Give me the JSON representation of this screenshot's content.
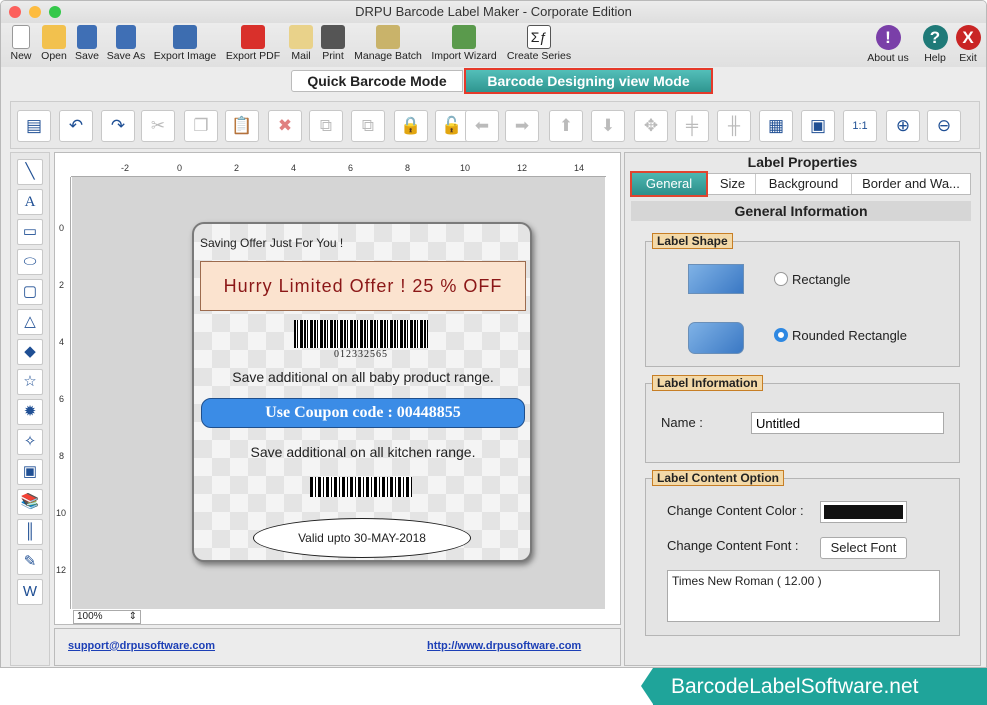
{
  "window": {
    "title": "DRPU Barcode Label Maker - Corporate Edition"
  },
  "toolbar": {
    "new": "New",
    "open": "Open",
    "save": "Save",
    "save_as": "Save As",
    "export_image": "Export Image",
    "export_pdf": "Export PDF",
    "mail": "Mail",
    "print": "Print",
    "manage_batch": "Manage Batch",
    "import_wizard": "Import Wizard",
    "create_series": "Create Series",
    "about": "About us",
    "help": "Help",
    "exit": "Exit"
  },
  "modes": {
    "quick": "Quick Barcode Mode",
    "designing": "Barcode Designing view Mode"
  },
  "ruler": {
    "h_ticks": [
      "-2",
      "0",
      "2",
      "4",
      "6",
      "8",
      "10",
      "12",
      "14"
    ],
    "v_ticks": [
      "0",
      "2",
      "4",
      "6",
      "8",
      "10",
      "12"
    ]
  },
  "zoom": "100%",
  "label": {
    "header": "Saving Offer Just For You !",
    "offer": "Hurry Limited Offer ! 25 % OFF",
    "barcode_number": "012332565",
    "line1": "Save additional on all baby product range.",
    "coupon": "Use Coupon code : 00448855",
    "line2": "Save additional on all kitchen range.",
    "valid": "Valid upto 30-MAY-2018"
  },
  "footer": {
    "email": "support@drpusoftware.com",
    "url": "http://www.drpusoftware.com"
  },
  "properties": {
    "title": "Label Properties",
    "tabs": [
      "General",
      "Size",
      "Background",
      "Border and Wa..."
    ],
    "section_title": "General Information",
    "shape": {
      "title": "Label Shape",
      "rect": "Rectangle",
      "rounded": "Rounded Rectangle",
      "selected": "Rounded Rectangle"
    },
    "info": {
      "title": "Label Information",
      "name_label": "Name :",
      "name_value": "Untitled"
    },
    "content": {
      "title": "Label Content Option",
      "color_label": "Change Content Color :",
      "font_label": "Change Content Font :",
      "font_button": "Select Font",
      "font_value": "Times New Roman ( 12.00 )",
      "color_value": "#111111"
    }
  },
  "brand": "BarcodeLabelSoftware.net"
}
